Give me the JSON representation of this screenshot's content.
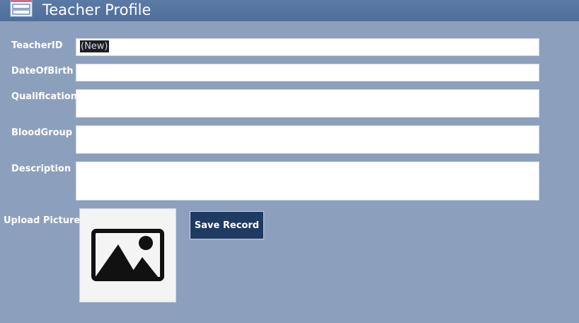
{
  "header": {
    "title": "Teacher Profile",
    "icon": "form-icon"
  },
  "fields": {
    "teacher_id": {
      "label": "TeacherID",
      "value": "(New)"
    },
    "date_of_birth": {
      "label": "DateOfBirth",
      "value": ""
    },
    "qualification": {
      "label": "Qualification",
      "value": ""
    },
    "blood_group": {
      "label": "BloodGroup",
      "value": ""
    },
    "description": {
      "label": "Description",
      "value": ""
    }
  },
  "upload": {
    "label": "Upload Picture",
    "icon": "image-placeholder-icon"
  },
  "save_button": {
    "label": "Save Record"
  },
  "colors": {
    "background": "#8ca0bd",
    "header": "#5472a0",
    "button": "#1f3b61"
  }
}
